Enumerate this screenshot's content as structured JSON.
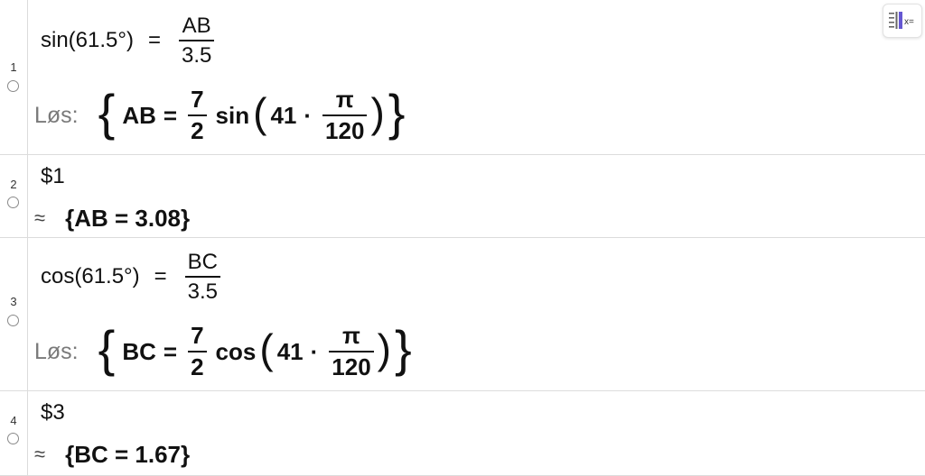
{
  "rows": [
    {
      "number": "1",
      "input": {
        "func": "sin(61.5°)",
        "eq": "=",
        "num": "AB",
        "den": "3.5"
      },
      "output": {
        "label": "Løs:",
        "open": "{",
        "lhs": "AB",
        "eq": "=",
        "coef_num": "7",
        "coef_den": "2",
        "func": "sin",
        "lparen": "(",
        "factor": "41",
        "cdot": "·",
        "pi": "π",
        "denom": "120",
        "rparen": ")",
        "close": "}"
      }
    },
    {
      "number": "2",
      "input": {
        "text": "$1"
      },
      "output": {
        "approx": "≈",
        "value": "{AB = 3.08}"
      }
    },
    {
      "number": "3",
      "input": {
        "func": "cos(61.5°)",
        "eq": "=",
        "num": "BC",
        "den": "3.5"
      },
      "output": {
        "label": "Løs:",
        "open": "{",
        "lhs": "BC",
        "eq": "=",
        "coef_num": "7",
        "coef_den": "2",
        "func": "cos",
        "lparen": "(",
        "factor": "41",
        "cdot": "·",
        "pi": "π",
        "denom": "120",
        "rparen": ")",
        "close": "}"
      }
    },
    {
      "number": "4",
      "input": {
        "text": "$3"
      },
      "output": {
        "approx": "≈",
        "value": "{BC = 1.67}"
      }
    }
  ],
  "keyboard_button": {
    "icon": "algebra-keyboard-icon",
    "accent": "#6557d2",
    "text": "x="
  }
}
